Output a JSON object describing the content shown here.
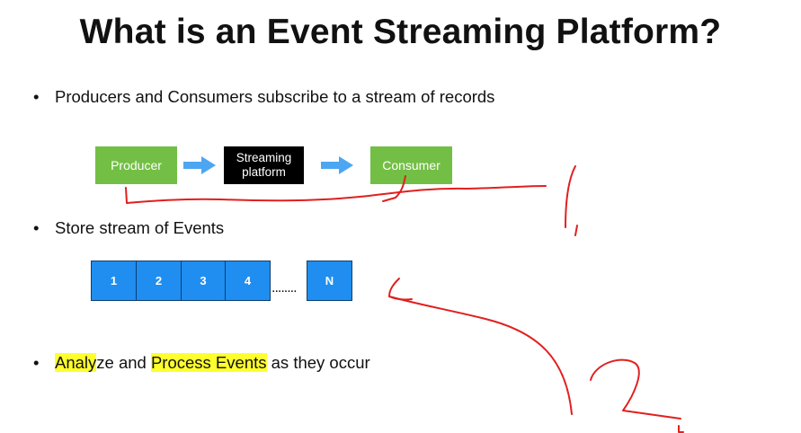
{
  "title": "What is an Event Streaming Platform?",
  "bullets": {
    "marker": "•",
    "b1": "Producers and Consumers subscribe to a stream of records",
    "b2": "Store stream of Events",
    "b3": {
      "hl1": "Analy",
      "t1": "ze and ",
      "hl2": "Process Events",
      "t2": " as they occur"
    }
  },
  "flow": {
    "producer": "Producer",
    "platform_line1": "Streaming",
    "platform_line2": "platform",
    "consumer": "Consumer"
  },
  "stream": {
    "cells": [
      "1",
      "2",
      "3",
      "4"
    ],
    "dots": "........",
    "last": "N"
  },
  "colors": {
    "green": "#73bf45",
    "blue": "#1f8ef0",
    "arrow_blue": "#4da6f2",
    "highlight": "#ffff2e",
    "ink": "#e0201f"
  }
}
